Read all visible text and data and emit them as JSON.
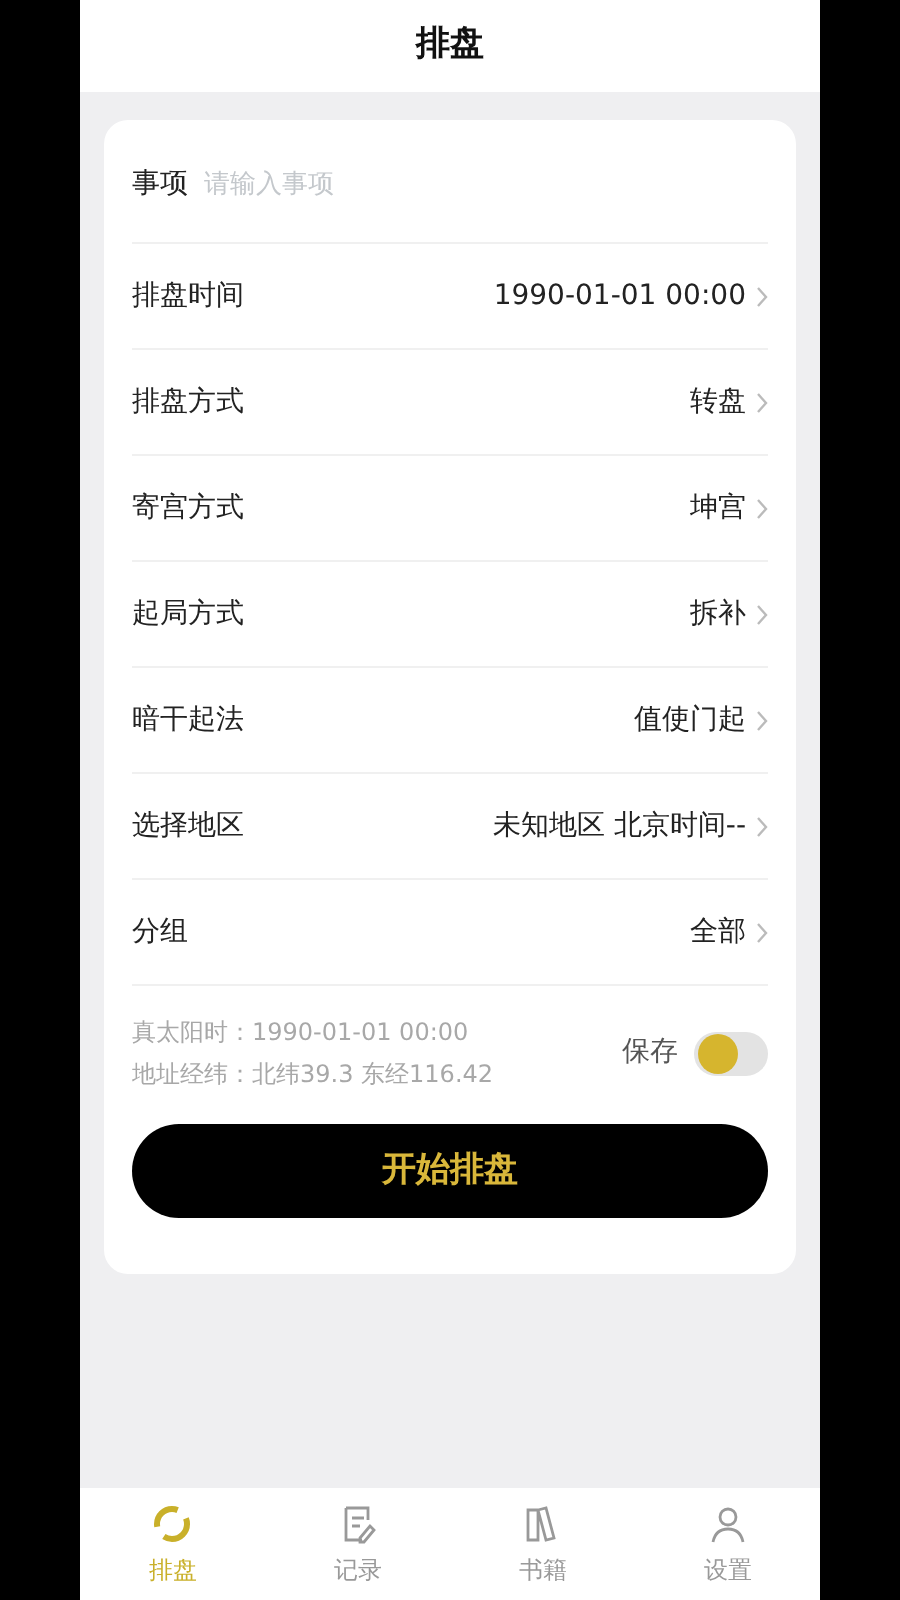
{
  "header": {
    "title": "排盘"
  },
  "subject": {
    "label": "事项",
    "placeholder": "请输入事项"
  },
  "rows": [
    {
      "label": "排盘时间",
      "value": "1990-01-01 00:00"
    },
    {
      "label": "排盘方式",
      "value": "转盘"
    },
    {
      "label": "寄宫方式",
      "value": "坤宫"
    },
    {
      "label": "起局方式",
      "value": "拆补"
    },
    {
      "label": "暗干起法",
      "value": "值使门起"
    },
    {
      "label": "选择地区",
      "value": "未知地区 北京时间--"
    },
    {
      "label": "分组",
      "value": "全部"
    }
  ],
  "info": [
    "真太阳时：1990-01-01 00:00",
    "地址经纬：北纬39.3 东经116.42"
  ],
  "save": {
    "label": "保存",
    "on": false
  },
  "start_button": "开始排盘",
  "tabs": [
    {
      "label": "排盘",
      "kind": "chart",
      "selected": true
    },
    {
      "label": "记录",
      "kind": "record",
      "selected": false
    },
    {
      "label": "书籍",
      "kind": "books",
      "selected": false
    },
    {
      "label": "设置",
      "kind": "user",
      "selected": false
    }
  ]
}
